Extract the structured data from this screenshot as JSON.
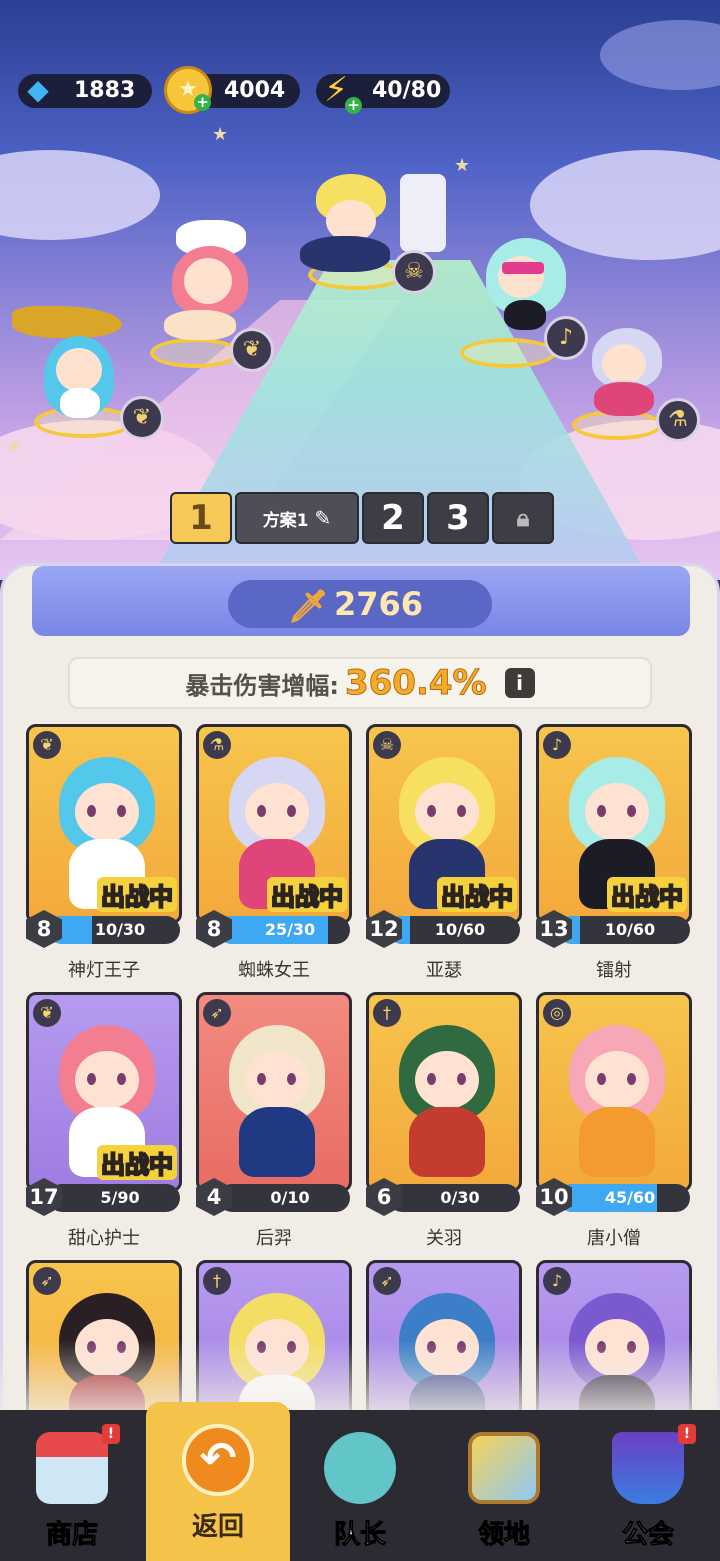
{
  "resources": {
    "gems": "1883",
    "gold": "4004",
    "energy": "40/80"
  },
  "formation": {
    "tabs": [
      "1",
      "2",
      "3"
    ],
    "active_tab": "1",
    "plan_name": "方案1"
  },
  "combat_power": "2766",
  "crit": {
    "label": "暴击伤害增幅:",
    "value": "360.4%"
  },
  "deploy_label": "出战中",
  "heroes": [
    {
      "name": "神灯王子",
      "level": "8",
      "progress": "10/30",
      "fraction": 0.33,
      "deployed": true,
      "frame": "gold",
      "class_icon": "wing-icon",
      "hair": "#53c8ea",
      "outfit": "#ffffff"
    },
    {
      "name": "蜘蛛女王",
      "level": "8",
      "progress": "25/30",
      "fraction": 0.83,
      "deployed": true,
      "frame": "gold",
      "class_icon": "potion-icon",
      "hair": "#d6d7f2",
      "outfit": "#e0457a"
    },
    {
      "name": "亚瑟",
      "level": "12",
      "progress": "10/60",
      "fraction": 0.17,
      "deployed": true,
      "frame": "gold",
      "class_icon": "skull-icon",
      "hair": "#f7df62",
      "outfit": "#27346d"
    },
    {
      "name": "镭射",
      "level": "13",
      "progress": "10/60",
      "fraction": 0.17,
      "deployed": true,
      "frame": "gold",
      "class_icon": "staff-icon",
      "hair": "#a8ece8",
      "outfit": "#1c1c26"
    },
    {
      "name": "甜心护士",
      "level": "17",
      "progress": "5/90",
      "fraction": 0.06,
      "deployed": true,
      "frame": "purple",
      "class_icon": "wing-icon",
      "hair": "#f37e92",
      "outfit": "#ffffff"
    },
    {
      "name": "后羿",
      "level": "4",
      "progress": "0/10",
      "fraction": 0,
      "deployed": false,
      "frame": "red",
      "class_icon": "bow-icon",
      "hair": "#f1e6c9",
      "outfit": "#1f3a82"
    },
    {
      "name": "关羽",
      "level": "6",
      "progress": "0/30",
      "fraction": 0,
      "deployed": false,
      "frame": "gold",
      "class_icon": "sword-icon",
      "hair": "#2f6a40",
      "outfit": "#c43b2f"
    },
    {
      "name": "唐小僧",
      "level": "10",
      "progress": "45/60",
      "fraction": 0.75,
      "deployed": false,
      "frame": "gold",
      "class_icon": "spiral-icon",
      "hair": "#f7a7b5",
      "outfit": "#f39b2f"
    },
    {
      "name": "",
      "level": "",
      "progress": "",
      "fraction": 0,
      "deployed": false,
      "frame": "gold",
      "class_icon": "bow-icon",
      "hair": "#2a1f22",
      "outfit": "#a8262b"
    },
    {
      "name": "",
      "level": "",
      "progress": "",
      "fraction": 0,
      "deployed": false,
      "frame": "purple",
      "class_icon": "sword-icon",
      "hair": "#f3dd62",
      "outfit": "#ffffff"
    },
    {
      "name": "",
      "level": "",
      "progress": "",
      "fraction": 0,
      "deployed": false,
      "frame": "purple",
      "class_icon": "bow-icon",
      "hair": "#3d7ec8",
      "outfit": "#3b4a8d"
    },
    {
      "name": "",
      "level": "",
      "progress": "",
      "fraction": 0,
      "deployed": false,
      "frame": "purple",
      "class_icon": "staff-icon",
      "hair": "#7b5ad0",
      "outfit": "#2d2440"
    }
  ],
  "nav": {
    "shop": "商店",
    "back": "返回",
    "captain": "队长",
    "territory": "领地",
    "guild": "公会",
    "alert_mark": "!"
  }
}
